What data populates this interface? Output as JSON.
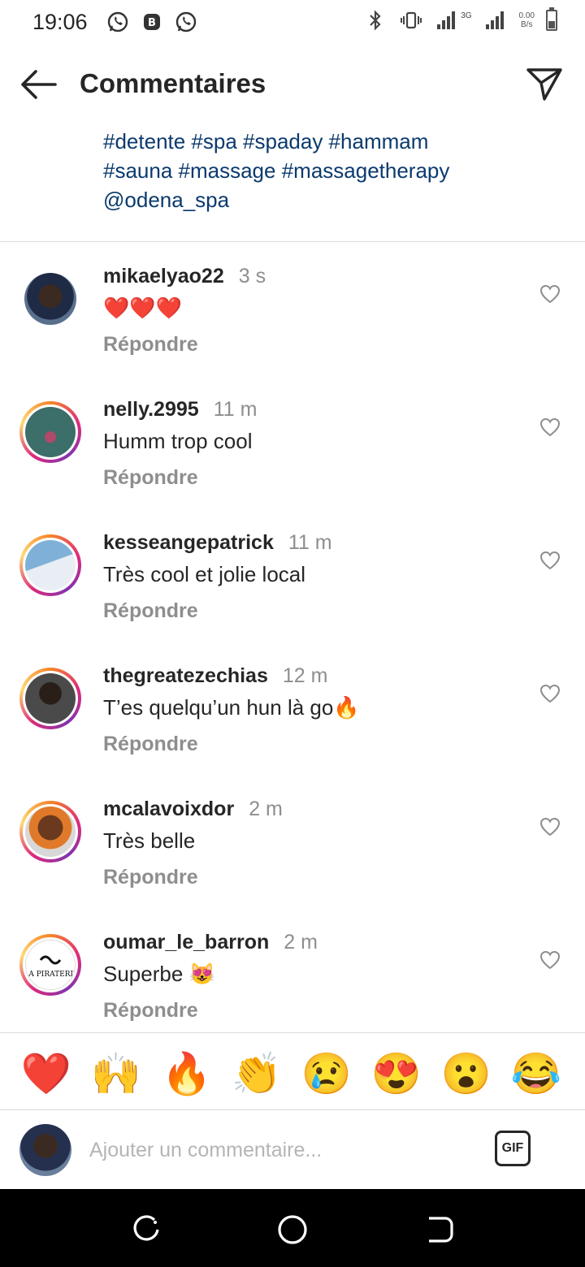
{
  "status_bar": {
    "time": "19:06",
    "net_speed_value": "0.00",
    "net_speed_unit": "B/s",
    "network_type": "3G",
    "left_icons": [
      "whatsapp-icon",
      "b-app-icon",
      "whatsapp-icon"
    ],
    "right_icons": [
      "bluetooth-icon",
      "vibrate-icon",
      "signal-icon",
      "signal-icon",
      "battery-icon"
    ]
  },
  "header": {
    "title": "Commentaires",
    "back_icon": "arrow-left-icon",
    "send_icon": "paper-plane-icon"
  },
  "caption": {
    "line1": "#detente #spa #spaday #hammam",
    "line2": "#sauna #massage #massagetherapy",
    "line3": "@odena_spa"
  },
  "comments": [
    {
      "username": "mikaelyao22",
      "time": "3 s",
      "text": "❤️❤️❤️",
      "reply": "Répondre",
      "story_ring": false
    },
    {
      "username": "nelly.2995",
      "time": "11 m",
      "text": "Humm trop cool",
      "reply": "Répondre",
      "story_ring": true
    },
    {
      "username": "kesseangepatrick",
      "time": "11 m",
      "text": "Très cool et jolie local",
      "reply": "Répondre",
      "story_ring": true
    },
    {
      "username": "thegreatezechias",
      "time": "12 m",
      "text": "T’es quelqu’un hun là go🔥",
      "reply": "Répondre",
      "story_ring": true
    },
    {
      "username": "mcalavoixdor",
      "time": "2 m",
      "text": "Très belle",
      "reply": "Répondre",
      "story_ring": true
    },
    {
      "username": "oumar_le_barron",
      "time": "2 m",
      "text": "Superbe 😻",
      "reply": "Répondre",
      "story_ring": true,
      "avatar_logo_text": "LA PIRATERIE"
    }
  ],
  "emoji_bar": [
    "❤️",
    "🙌",
    "🔥",
    "👏",
    "😢",
    "😍",
    "😮",
    "😂"
  ],
  "comment_input": {
    "placeholder": "Ajouter un commentaire...",
    "gif_label": "GIF"
  },
  "colors": {
    "link_blue": "#0b3a6e",
    "secondary_text": "#8e8e8e",
    "primary_text": "#262626",
    "divider": "#dbdbdb"
  }
}
